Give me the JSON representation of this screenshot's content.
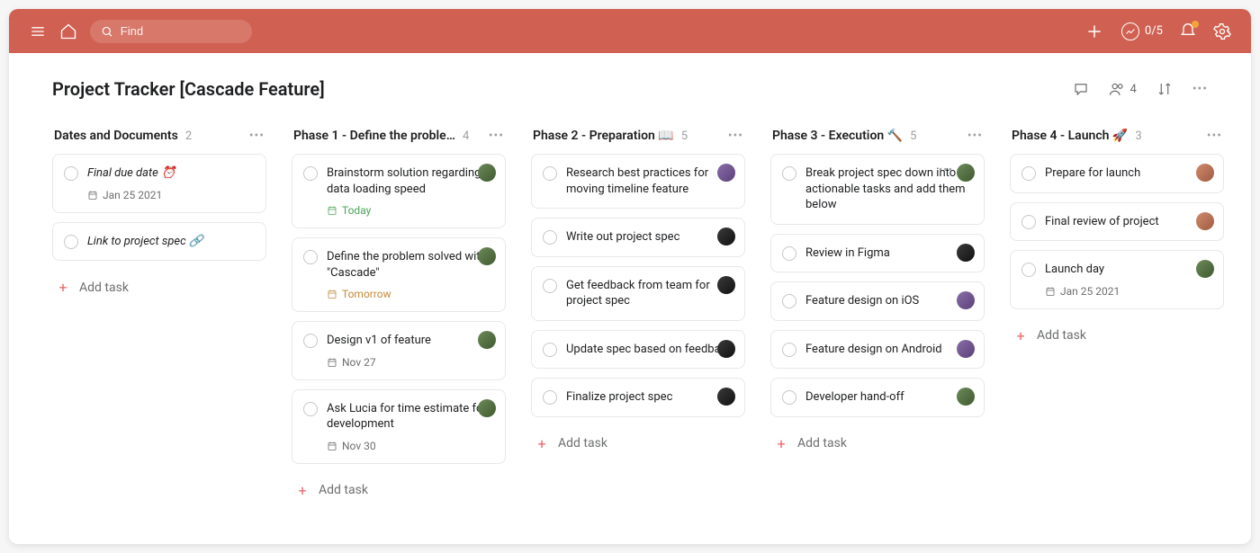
{
  "header": {
    "searchPlaceholder": "Find",
    "trendText": "0/5"
  },
  "project": {
    "title": "Project Tracker [Cascade Feature]",
    "memberCount": "4"
  },
  "addTaskLabel": "Add task",
  "columns": [
    {
      "title": "Dates and Documents",
      "count": "2",
      "cards": [
        {
          "title": "Final due date ⏰",
          "italic": true,
          "date": "Jan 25 2021"
        },
        {
          "title": "Link to project spec 🔗",
          "italic": true
        }
      ]
    },
    {
      "title": "Phase 1 - Define the proble...",
      "count": "4",
      "cards": [
        {
          "title": "Brainstorm solution regarding data loading speed",
          "date": "Today",
          "dateClass": "green",
          "avatar": "a"
        },
        {
          "title": "Define the problem solved with \"Cascade\"",
          "date": "Tomorrow",
          "dateClass": "amber",
          "avatar": "a"
        },
        {
          "title": "Design v1 of feature",
          "date": "Nov 27",
          "avatar": "a"
        },
        {
          "title": "Ask Lucia for time estimate for development",
          "date": "Nov 30",
          "avatar": "a"
        }
      ]
    },
    {
      "title": "Phase 2 - Preparation 📖",
      "count": "5",
      "cards": [
        {
          "title": "Research best practices for moving timeline feature",
          "avatar": "b"
        },
        {
          "title": "Write out project spec",
          "avatar": "d"
        },
        {
          "title": "Get feedback from team for project spec",
          "avatar": "d"
        },
        {
          "title": "Update spec based on feedback",
          "avatar": "d"
        },
        {
          "title": "Finalize project spec",
          "avatar": "d"
        }
      ]
    },
    {
      "title": "Phase 3 - Execution 🔨",
      "count": "5",
      "cards": [
        {
          "title": "Break project spec down into actionable tasks and add them below",
          "avatar": "a",
          "showMore": true
        },
        {
          "title": "Review in Figma",
          "avatar": "d"
        },
        {
          "title": "Feature design on iOS",
          "avatar": "b"
        },
        {
          "title": "Feature design on Android",
          "avatar": "b"
        },
        {
          "title": "Developer hand-off",
          "avatar": "a"
        }
      ]
    },
    {
      "title": "Phase 4 - Launch 🚀",
      "count": "3",
      "cards": [
        {
          "title": "Prepare for launch",
          "avatar": "c"
        },
        {
          "title": "Final review of project",
          "avatar": "c"
        },
        {
          "title": "Launch day",
          "date": "Jan 25 2021",
          "avatar": "a"
        }
      ]
    }
  ]
}
